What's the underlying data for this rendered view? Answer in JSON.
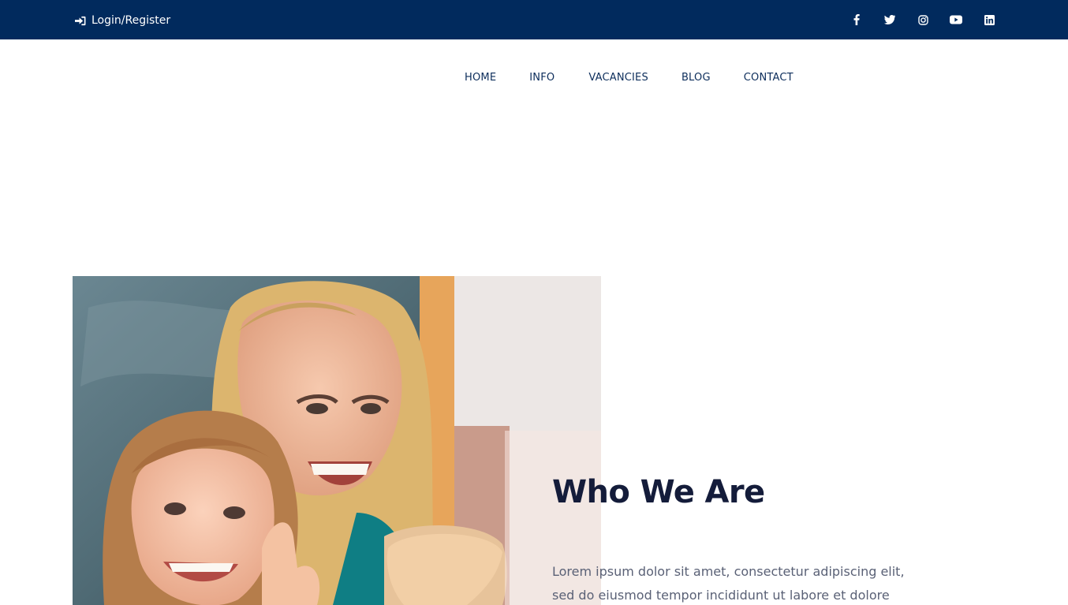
{
  "topbar": {
    "login_label": "Login/Register",
    "social": [
      "facebook-icon",
      "twitter-icon",
      "instagram-icon",
      "youtube-icon",
      "linkedin-icon"
    ]
  },
  "nav": {
    "items": [
      "HOME",
      "INFO",
      "VACANCIES",
      "BLOG",
      "CONTACT"
    ]
  },
  "about": {
    "heading": "Who We Are",
    "paragraph_line1": "Lorem ipsum dolor sit amet, consectetur adipiscing elit,",
    "paragraph_line2": "sed do eiusmod tempor incididunt ut labore et dolore"
  },
  "colors": {
    "topbar": "#012a5d",
    "nav_text": "#0c2d5b",
    "heading": "#141c3a",
    "body_text": "#5a6176"
  }
}
